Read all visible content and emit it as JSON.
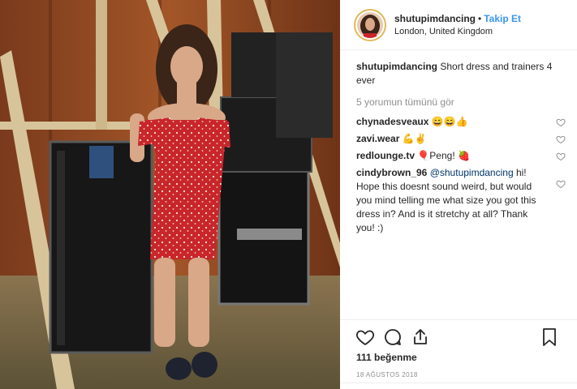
{
  "post": {
    "username": "shutupimdancing",
    "separator": "•",
    "follow_label": "Takip Et",
    "location": "London, United Kingdom"
  },
  "caption": {
    "username": "shutupimdancing",
    "text": "Short dress and trainers 4 ever"
  },
  "view_comments_label": "5 yorumun tümünü gör",
  "comments": [
    {
      "username": "chynadesveaux",
      "text": "😄😄👍"
    },
    {
      "username": "zavi.wear",
      "text": "💪✌"
    },
    {
      "username": "redlounge.tv",
      "text": "🎈Peng! 🍓"
    },
    {
      "username": "cindybrown_96",
      "mention": "@shutupimdancing",
      "text": " hi! Hope this doesnt sound weird, but would you mind telling me what size you got this dress in? And is it stretchy at all? Thank you! :)"
    }
  ],
  "likes_label": "111 beğenme",
  "date_label": "18 AĞUSTOS 2018",
  "icons": [
    "heart-icon",
    "comment-icon",
    "share-icon",
    "bookmark-icon"
  ],
  "colors": {
    "follow": "#3897f0",
    "muted": "#8e8e8e",
    "dress": "#c8262b"
  }
}
